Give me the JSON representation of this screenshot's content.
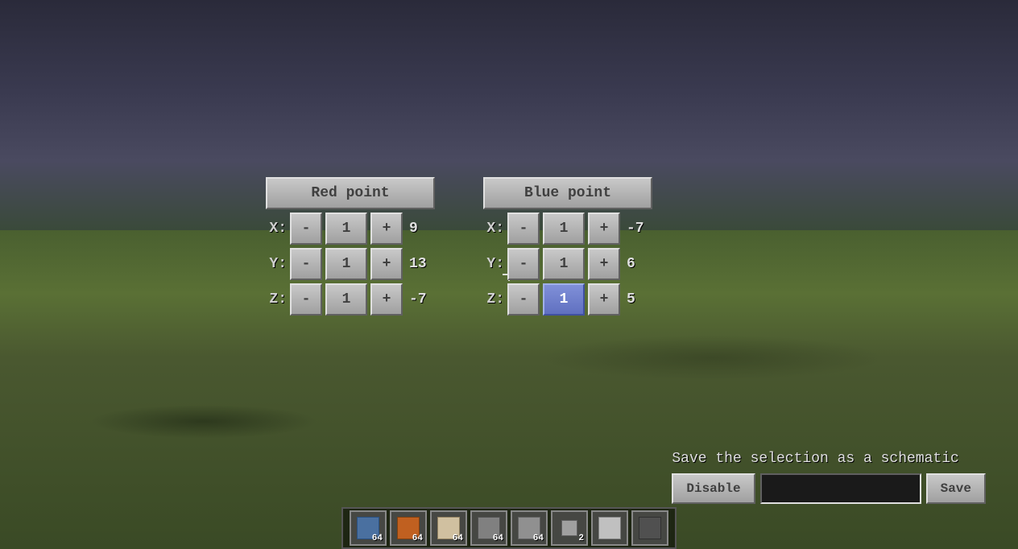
{
  "background": {
    "description": "Minecraft world view with grass and stone structures"
  },
  "red_point_panel": {
    "title": "Red point",
    "x_label": "X:",
    "y_label": "Y:",
    "z_label": "Z:",
    "x_minus": "-",
    "x_value": "1",
    "x_plus": "+",
    "x_result": "9",
    "y_minus": "-",
    "y_value": "1",
    "y_plus": "+",
    "y_result": "13",
    "z_minus": "-",
    "z_value": "1",
    "z_plus": "+",
    "z_result": "-7"
  },
  "blue_point_panel": {
    "title": "Blue point",
    "x_label": "X:",
    "y_label": "Y:",
    "z_label": "Z:",
    "x_minus": "-",
    "x_value": "1",
    "x_plus": "+",
    "x_result": "-7",
    "y_minus": "-",
    "y_value": "1",
    "y_plus": "+",
    "y_result": "6",
    "z_minus": "-",
    "z_value": "1",
    "z_plus": "+",
    "z_result": "5",
    "z_value_highlighted": true
  },
  "save_panel": {
    "title": "Save the selection as a schematic",
    "disable_label": "Disable",
    "save_label": "Save",
    "input_placeholder": ""
  },
  "hotbar": {
    "slots": [
      {
        "count": "64",
        "type": "chest"
      },
      {
        "count": "64",
        "type": "orange"
      },
      {
        "count": "64",
        "type": "web"
      },
      {
        "count": "64",
        "type": "gray"
      },
      {
        "count": "64",
        "type": "gray2"
      },
      {
        "count": "2",
        "type": "small"
      },
      {
        "count": "",
        "type": "white"
      },
      {
        "count": "",
        "type": "dark"
      }
    ]
  }
}
